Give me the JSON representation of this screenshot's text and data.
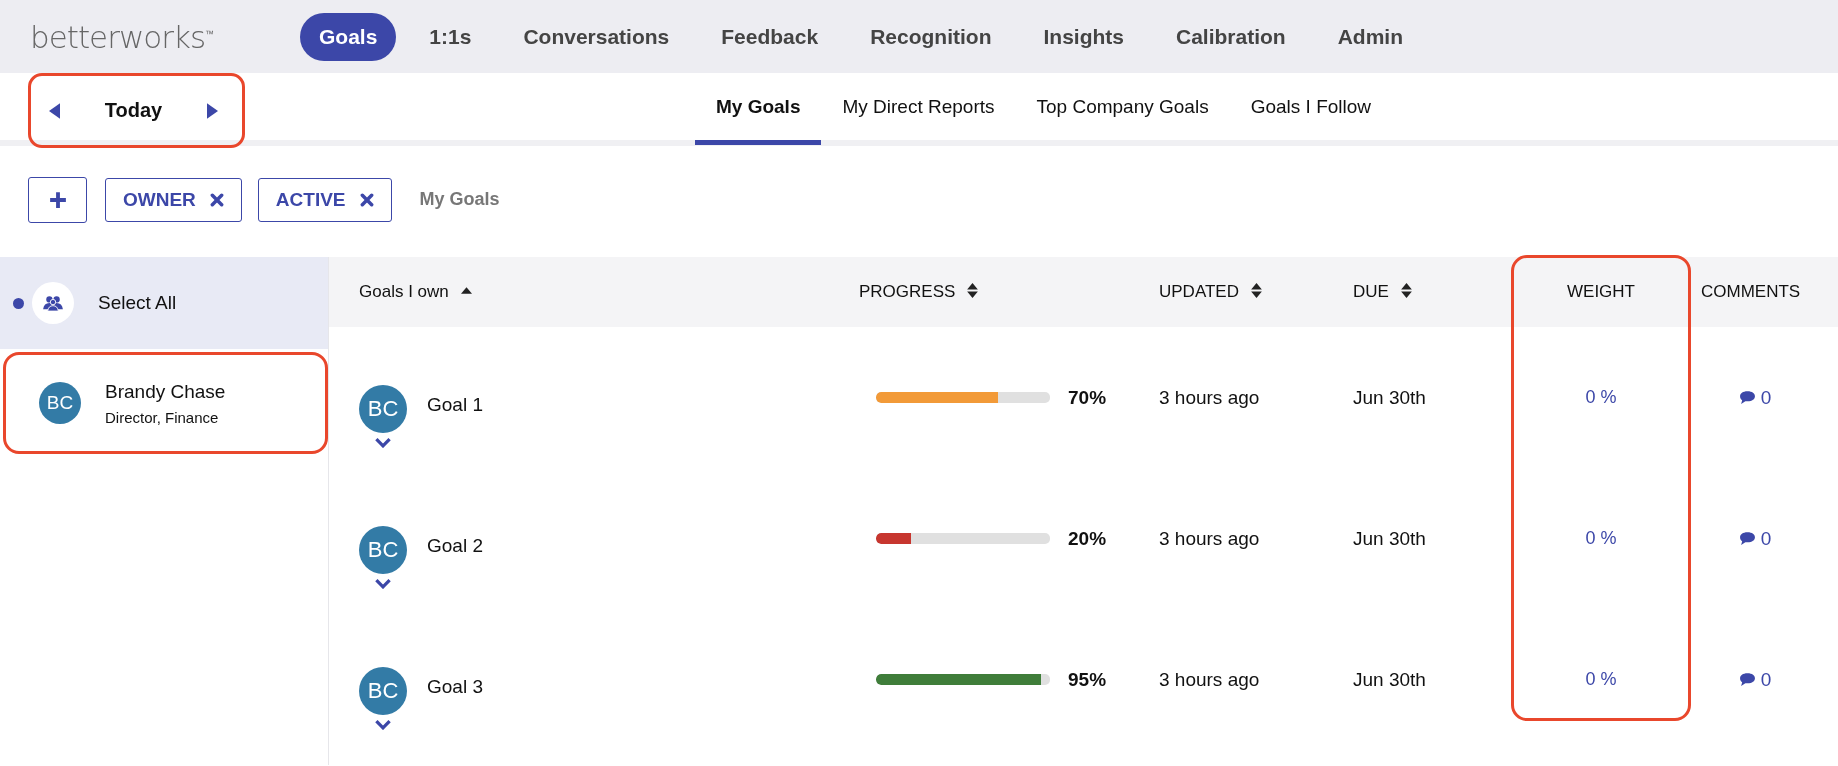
{
  "logo": "betterworks",
  "logo_mark": "™",
  "nav": [
    {
      "label": "Goals",
      "selected": true
    },
    {
      "label": "1:1s",
      "selected": false
    },
    {
      "label": "Conversations",
      "selected": false
    },
    {
      "label": "Feedback",
      "selected": false
    },
    {
      "label": "Recognition",
      "selected": false
    },
    {
      "label": "Insights",
      "selected": false
    },
    {
      "label": "Calibration",
      "selected": false
    },
    {
      "label": "Admin",
      "selected": false
    }
  ],
  "date_nav": {
    "label": "Today",
    "highlighted": true
  },
  "subtabs": [
    {
      "label": "My Goals",
      "selected": true
    },
    {
      "label": "My Direct Reports",
      "selected": false
    },
    {
      "label": "Top Company Goals",
      "selected": false
    },
    {
      "label": "Goals I Follow",
      "selected": false
    }
  ],
  "filters": [
    {
      "label": "OWNER"
    },
    {
      "label": "ACTIVE"
    }
  ],
  "filter_caption": "My Goals",
  "sidebar": {
    "select_all": {
      "label": "Select All",
      "selected": true
    },
    "people": [
      {
        "initials": "BC",
        "name": "Brandy Chase",
        "title": "Director, Finance",
        "highlighted": true
      }
    ]
  },
  "table": {
    "weight_column_highlighted": true,
    "columns": [
      {
        "label": "Goals I own",
        "kind": "sorted"
      },
      {
        "label": "PROGRESS",
        "kind": "sortable"
      },
      {
        "label": "UPDATED",
        "kind": "sortable"
      },
      {
        "label": "DUE",
        "kind": "sortable"
      },
      {
        "label": "WEIGHT",
        "kind": "plain"
      },
      {
        "label": "COMMENTS",
        "kind": "plain"
      }
    ],
    "rows": [
      {
        "initials": "BC",
        "goal": "Goal 1",
        "level": 0.7,
        "color": "#f29a38",
        "progress": "70%",
        "updated": "3 hours ago",
        "due": "Jun 30th",
        "weight": "0 %",
        "comments": "0"
      },
      {
        "initials": "BC",
        "goal": "Goal 2",
        "level": 0.2,
        "color": "#c7362f",
        "progress": "20%",
        "updated": "3 hours ago",
        "due": "Jun 30th",
        "weight": "0 %",
        "comments": "0"
      },
      {
        "initials": "BC",
        "goal": "Goal 3",
        "level": 0.95,
        "color": "#3f7d3a",
        "progress": "95%",
        "updated": "3 hours ago",
        "due": "Jun 30th",
        "weight": "0 %",
        "comments": "0"
      }
    ]
  }
}
